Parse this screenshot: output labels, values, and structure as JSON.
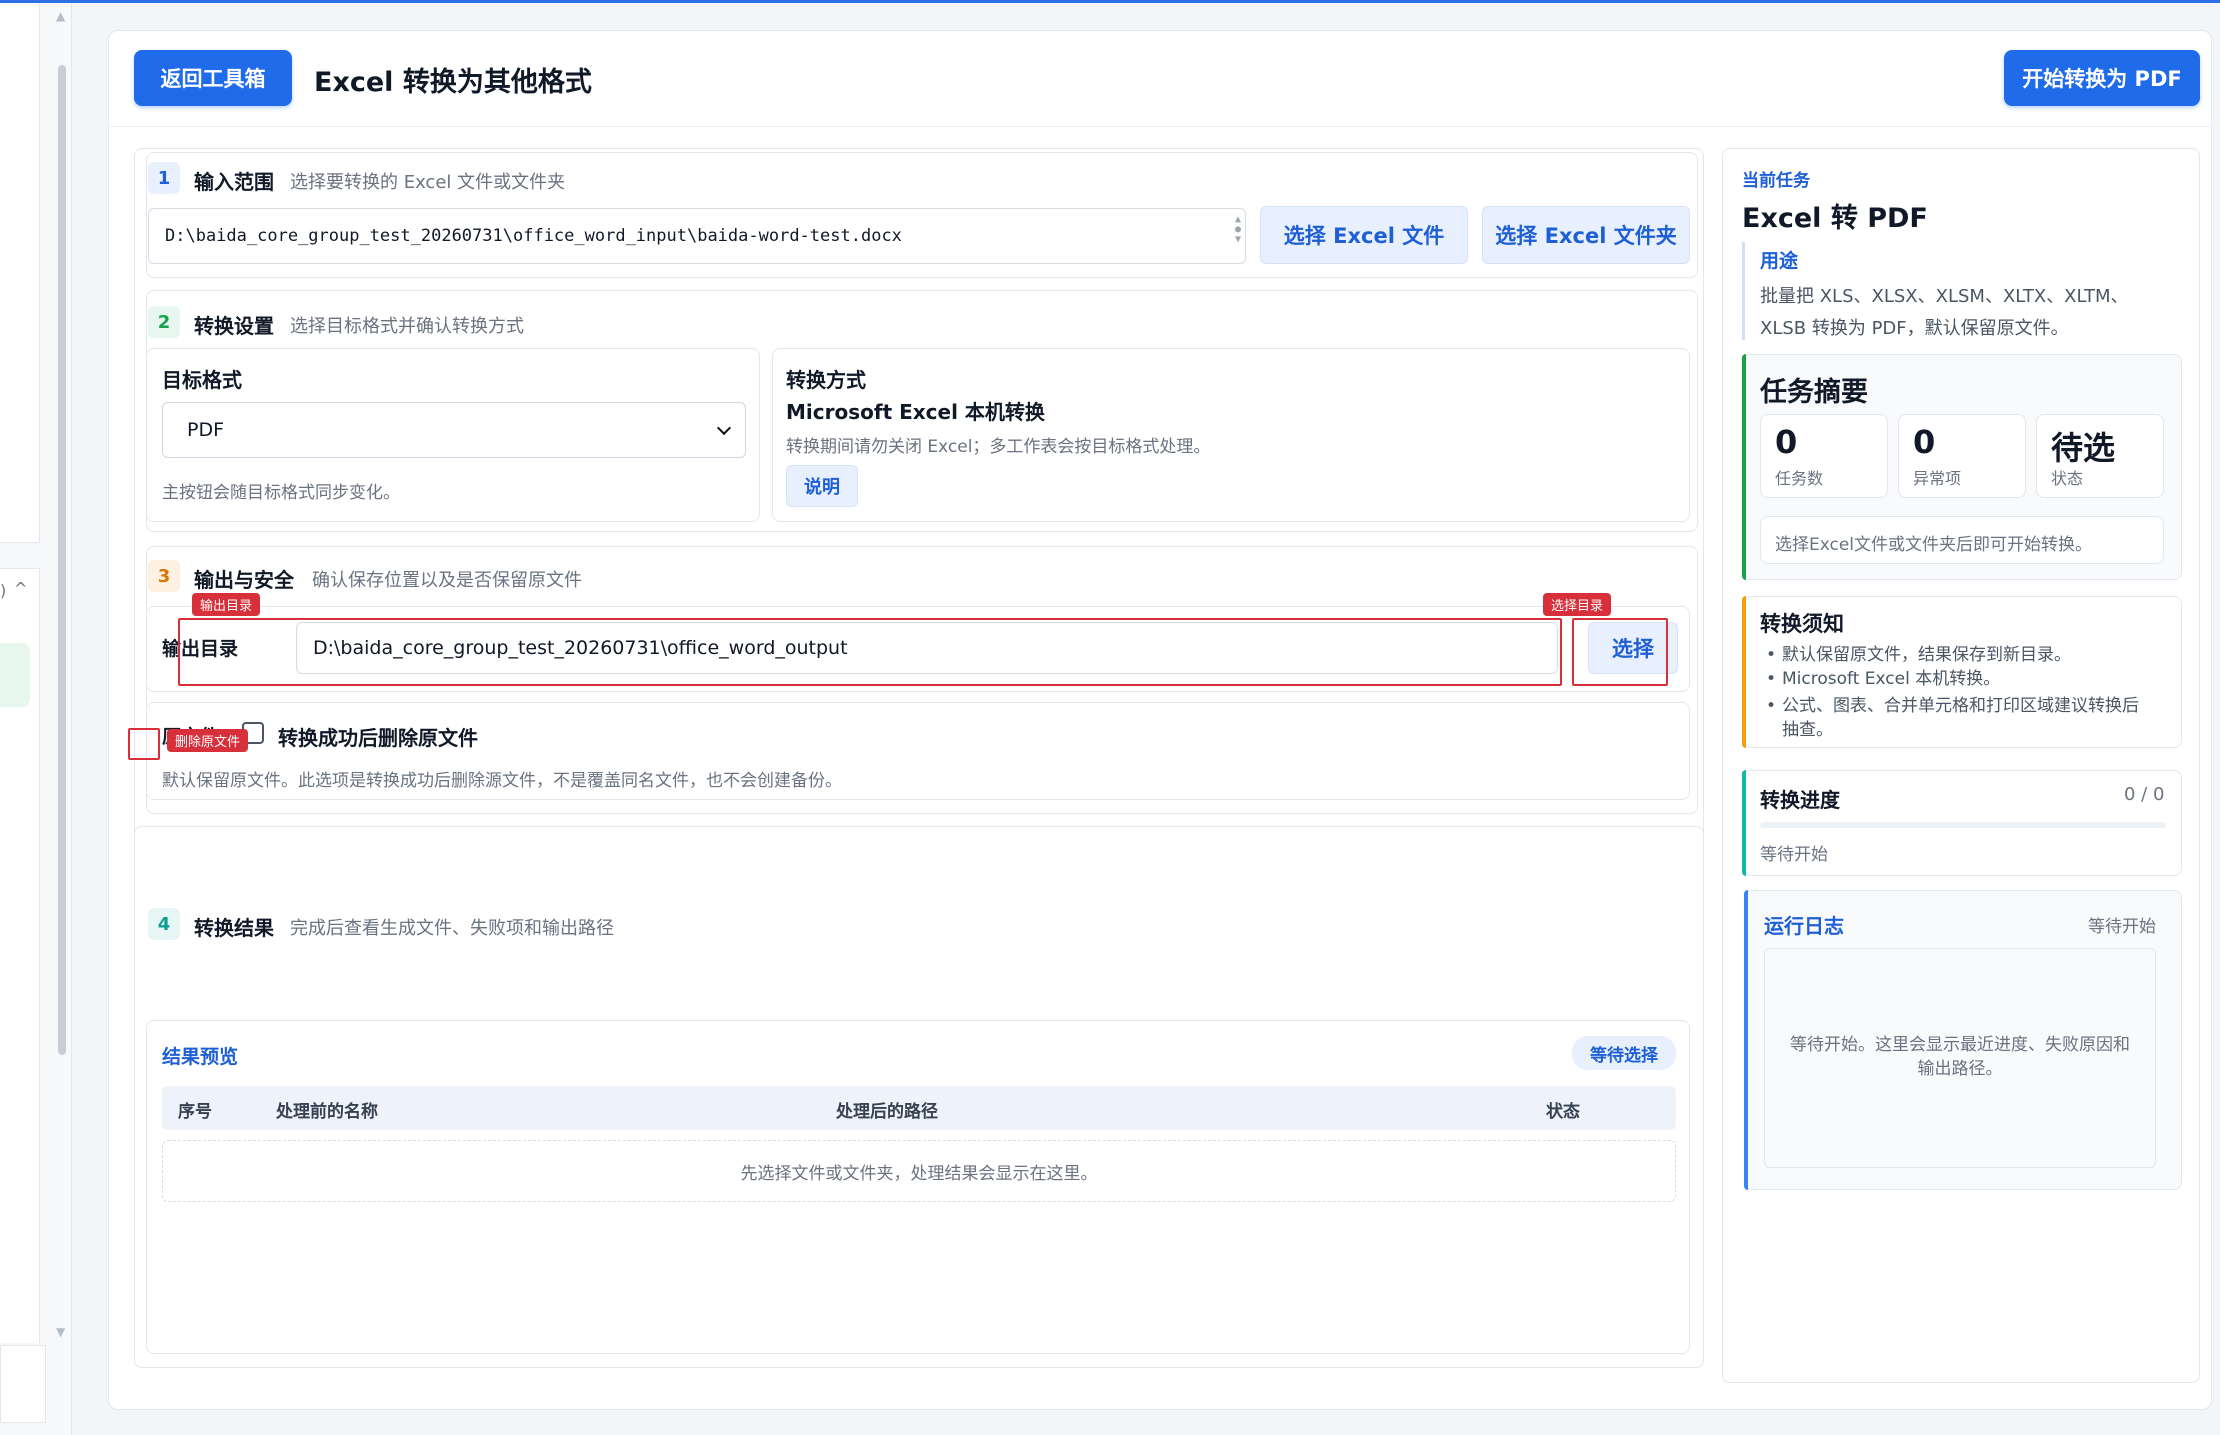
{
  "header": {
    "back_label": "返回工具箱",
    "title": "Excel 转换为其他格式",
    "start_label": "开始转换为 PDF"
  },
  "step1": {
    "num": "1",
    "title": "输入范围",
    "subtitle": "选择要转换的 Excel 文件或文件夹",
    "input_path": "D:\\baida_core_group_test_20260731\\office_word_input\\baida-word-test.docx",
    "btn_file": "选择 Excel 文件",
    "btn_folder": "选择 Excel 文件夹"
  },
  "step2": {
    "num": "2",
    "title": "转换设置",
    "subtitle": "选择目标格式并确认转换方式",
    "target_label": "目标格式",
    "target_value": "PDF",
    "target_hint": "主按钮会随目标格式同步变化。",
    "method_label": "转换方式",
    "method_value": "Microsoft Excel 本机转换",
    "method_hint": "转换期间请勿关闭 Excel；多工作表会按目标格式处理。",
    "explain_label": "说明"
  },
  "step3": {
    "num": "3",
    "title": "输出与安全",
    "subtitle": "确认保存位置以及是否保留原文件",
    "output_label": "输出目录",
    "output_path": "D:\\baida_core_group_test_20260731\\office_word_output",
    "choose_label": "选择",
    "tag_output": "输出目录",
    "tag_choose": "选择目录",
    "orig_label": "原文件",
    "delete_label": "转换成功后删除原文件",
    "tag_delete": "删除原文件",
    "delete_hint": "默认保留原文件。此选项是转换成功后删除源文件，不是覆盖同名文件，也不会创建备份。"
  },
  "step4": {
    "num": "4",
    "title": "转换结果",
    "subtitle": "完成后查看生成文件、失败项和输出路径",
    "preview_label": "结果预览",
    "preview_status": "等待选择",
    "columns": [
      "序号",
      "处理前的名称",
      "处理后的路径",
      "状态"
    ],
    "empty_text": "先选择文件或文件夹，处理结果会显示在这里。"
  },
  "side": {
    "current_task_label": "当前任务",
    "task_name": "Excel 转 PDF",
    "usage_label": "用途",
    "usage_text_1": "批量把 XLS、XLSX、XLSM、XLTX、XLTM、",
    "usage_text_2": "XLSB 转换为 PDF，默认保留原文件。",
    "summary_title": "任务摘要",
    "stats": [
      {
        "value": "0",
        "label": "任务数"
      },
      {
        "value": "0",
        "label": "异常项"
      },
      {
        "value": "待选",
        "label": "状态"
      }
    ],
    "summary_hint": "选择Excel文件或文件夹后即可开始转换。",
    "notice_title": "转换须知",
    "notice_items": [
      "默认保留原文件，结果保存到新目录。",
      "Microsoft Excel 本机转换。",
      "公式、图表、合并单元格和打印区域建议转换后",
      "抽查。"
    ],
    "progress_title": "转换进度",
    "progress_count": "0 / 0",
    "progress_value": 0,
    "progress_status": "等待开始",
    "log_title": "运行日志",
    "log_status": "等待开始",
    "log_text_1": "等待开始。这里会显示最近进度、失败原因和",
    "log_text_2": "输出路径。"
  },
  "colors": {
    "primary": "#1f6bea",
    "green_accent": "#16a34a",
    "orange_accent": "#f59e0b",
    "teal_accent": "#14b8a6",
    "blue_accent": "#3b82f6",
    "annotation_red": "#d8303a"
  }
}
